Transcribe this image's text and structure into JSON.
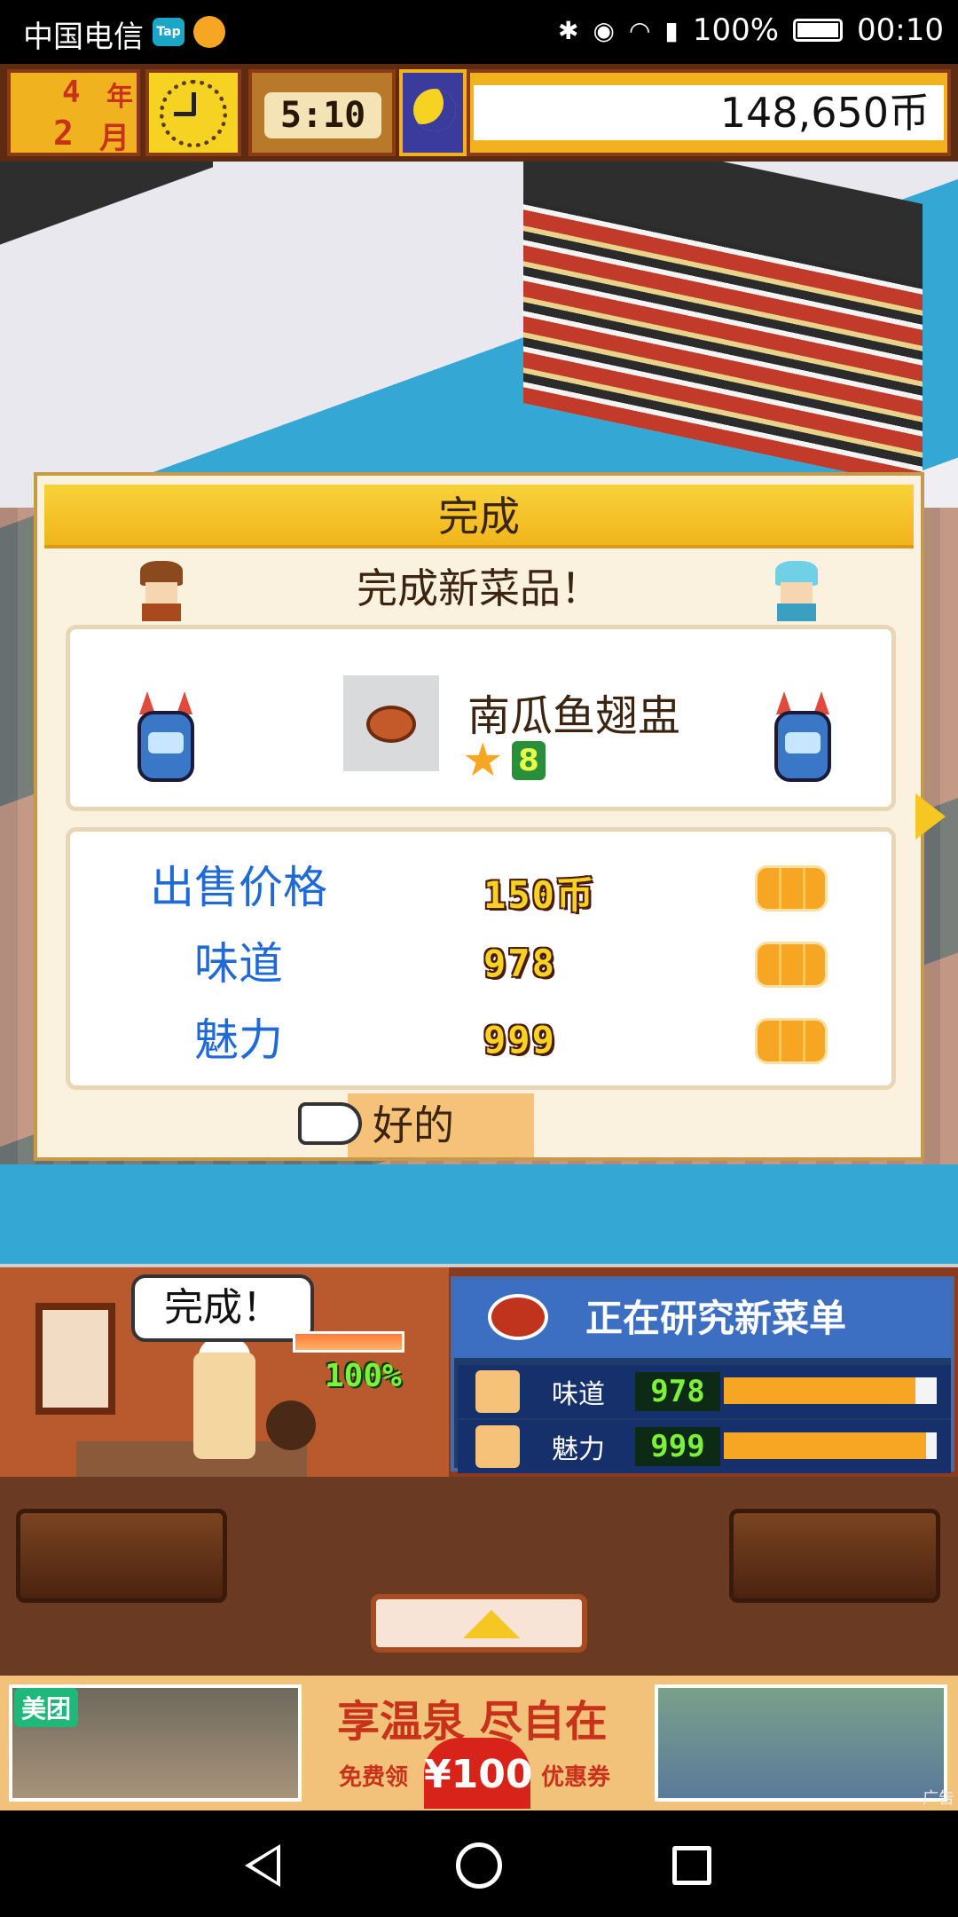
{
  "status_bar": {
    "carrier": "中国电信",
    "tap_badge": "Tap",
    "battery": "100%",
    "time": "00:10",
    "icons": [
      "bluetooth-icon",
      "eye-icon",
      "wifi-icon",
      "signal-4g-icon",
      "battery-icon"
    ]
  },
  "hud": {
    "year_num": "4",
    "year_label": "年",
    "month_num": "2",
    "month_label": "月",
    "game_time": "5:10",
    "money": "148,650币"
  },
  "dialog": {
    "title": "完成",
    "subtitle": "完成新菜品！",
    "dish_name": "南瓜鱼翅盅",
    "stars": "8",
    "stats": [
      {
        "label": "出售价格",
        "value": "150币",
        "rating_icons": "$$$"
      },
      {
        "label": "味道",
        "value": "978",
        "rating_icons": "$$$"
      },
      {
        "label": "魅力",
        "value": "999",
        "rating_icons": "$$$"
      }
    ],
    "ok_label": "好的"
  },
  "kitchen": {
    "speech": "完成！",
    "progress": "100%",
    "progress_fraction": 1.0,
    "research_title": "正在研究新菜单",
    "research_rows": [
      {
        "label": "味道",
        "value": "978",
        "fill": 0.9
      },
      {
        "label": "魅力",
        "value": "999",
        "fill": 0.95
      }
    ]
  },
  "ad": {
    "brand": "美团",
    "headline": "享温泉 尽自在",
    "free_label": "免费领",
    "amount": "¥100",
    "coupon_label": "优惠券",
    "ad_tag": "广告"
  },
  "colors": {
    "accent_gold": "#f2b51c",
    "stat_blue": "#1f6ad6",
    "research_blue": "#3c6fc2",
    "water": "#34a7d4"
  }
}
